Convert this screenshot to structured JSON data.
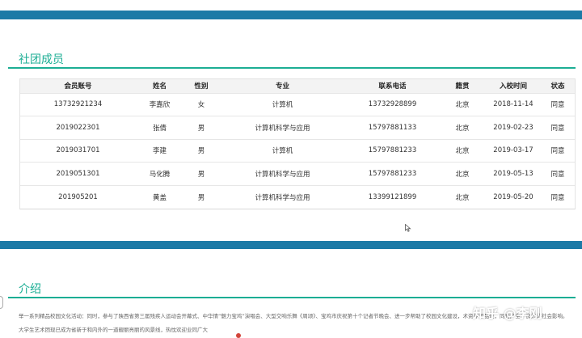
{
  "members": {
    "title": "社团成员",
    "columns": [
      "会员账号",
      "姓名",
      "性别",
      "专业",
      "联系电话",
      "籍贯",
      "入校时间",
      "状态"
    ],
    "rows": [
      [
        "13732921234",
        "李嘉欣",
        "女",
        "计算机",
        "13732928899",
        "北京",
        "2018-11-14",
        "同意"
      ],
      [
        "2019022301",
        "张倩",
        "男",
        "计算机科学与应用",
        "15797881133",
        "北京",
        "2019-02-23",
        "同意"
      ],
      [
        "2019031701",
        "李建",
        "男",
        "计算机",
        "15797881233",
        "北京",
        "2019-03-17",
        "同意"
      ],
      [
        "2019051301",
        "马化腾",
        "男",
        "计算机科学与应用",
        "15797881233",
        "北京",
        "2019-05-13",
        "同意"
      ],
      [
        "201905201",
        "黄盖",
        "男",
        "计算机科学与应用",
        "13399121899",
        "北京",
        "2019-05-20",
        "同意"
      ]
    ]
  },
  "intro": {
    "title": "介绍",
    "line1": "举一系列精品校园文化活动：同时，参与了陕西省第三届残疾人运动会开幕式、中华情“魅力宝鸡”演唱会、大型交响乐舞《周颂》、宝鸡市庆祝第十个记者节晚会、进一步帮助了校园文化建设，术资养和品位，同时产生了良好的社会影响。",
    "line2": "大学生艺术团现已成为省新于和内外的一道靓丽亮丽的风景线，热忱欢迎业同广大"
  },
  "watermark": "知乎 @李刚",
  "colors": {
    "band": "#1c7aa6",
    "accent": "#1cae94"
  }
}
